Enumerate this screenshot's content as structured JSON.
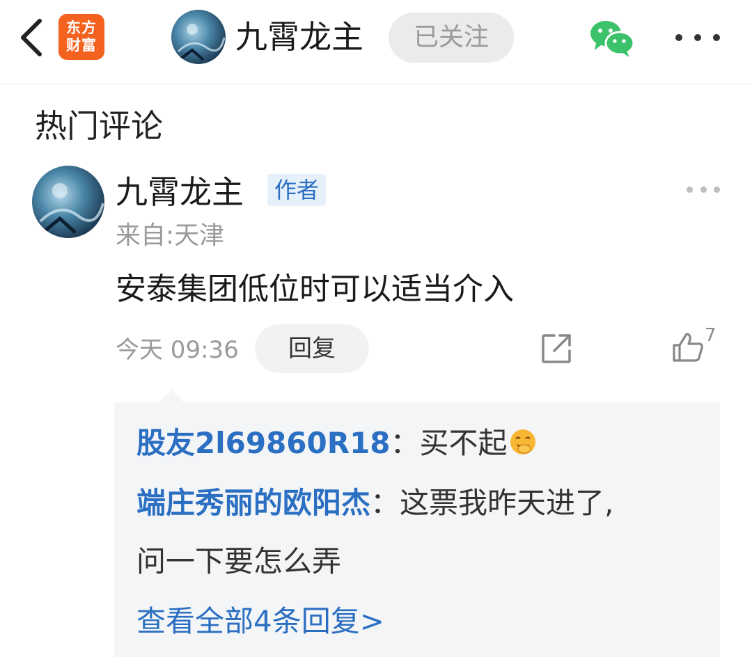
{
  "header": {
    "back_label": "返回",
    "logo_line1": "东方",
    "logo_line2": "财富",
    "user_name": "九霄龙主",
    "follow_label": "已关注",
    "share_icon": "wechat-icon",
    "more_icon": "more-icon"
  },
  "section": {
    "title": "热门评论"
  },
  "comment": {
    "author": "九霄龙主",
    "author_tag": "作者",
    "location": "来自:天津",
    "text": "安泰集团低位时可以适当介入",
    "time": "今天 09:36",
    "reply_label": "回复",
    "like_count": "7",
    "replies": [
      {
        "name": "股友2l69860R18",
        "separator": "：",
        "text": "买不起"
      },
      {
        "name": "端庄秀丽的欧阳杰",
        "separator": "：",
        "text": "这票我昨天进了,",
        "text_cont": "问一下要怎么弄"
      }
    ],
    "view_all": "查看全部4条回复>"
  },
  "colors": {
    "accent_blue": "#2a6fc2",
    "logo_orange": "#f4621f",
    "wechat_green": "#3cc26a"
  }
}
